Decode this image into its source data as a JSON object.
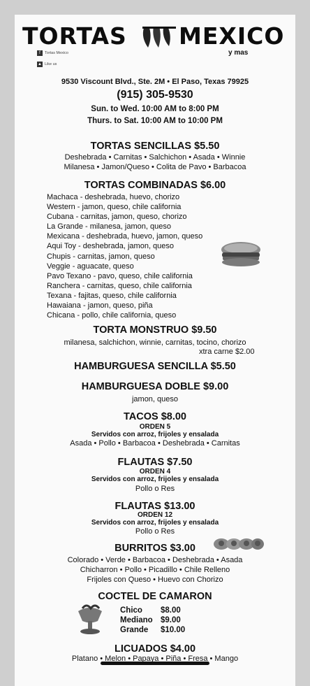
{
  "header": {
    "brand_left": "TORTAS",
    "brand_right": "MEXICO",
    "tagline": "y mas",
    "facebook_name": "Tortas Mexico",
    "like_label": "Like us"
  },
  "contact": {
    "address": "9530 Viscount Blvd., Ste. 2M  •  El Paso, Texas 79925",
    "phone": "(915) 305-9530",
    "hours_1": "Sun. to Wed.  10:00 AM to 8:00 PM",
    "hours_2": "Thurs. to Sat.  10:00 AM to 10:00 PM"
  },
  "menu": {
    "sencillas_title": "TORTAS SENCILLAS   $5.50",
    "sencillas_line1": "Deshebrada • Carnitas • Salchichon • Asada • Winnie",
    "sencillas_line2": "Milanesa • Jamon/Queso • Colita de Pavo • Barbacoa",
    "combinadas_title": "TORTAS COMBINADAS   $6.00",
    "combinadas": [
      "Machaca - deshebrada, huevo, chorizo",
      "Western - jamon, queso, chile california",
      "Cubana - carnitas, jamon, queso, chorizo",
      "La Grande - milanesa, jamon, queso",
      "Mexicana - deshebrada, huevo, jamon, queso",
      "Aqui Toy - deshebrada, jamon, queso",
      "Chupis - carnitas, jamon, queso",
      "Veggie - aguacate, queso",
      "Pavo Texano - pavo, queso, chile california",
      "Ranchera - carnitas, queso, chile california",
      "Texana - fajitas, queso, chile california",
      "Hawaiana - jamon, queso, piña",
      "Chicana - pollo, chile california, queso"
    ],
    "monstruo_title": "TORTA MONSTRUO   $9.50",
    "monstruo_desc": "milanesa, salchichon, winnie, carnitas, tocino, chorizo",
    "monstruo_extra": "xtra carne  $2.00",
    "hamb_sencilla": "HAMBURGUESA SENCILLA   $5.50",
    "hamb_doble": "HAMBURGUESA DOBLE   $9.00",
    "hamb_doble_desc": "jamon, queso",
    "tacos_title": "TACOS   $8.00",
    "tacos_orden": "ORDEN 5",
    "tacos_served": "Servidos con arroz, frijoles y ensalada",
    "tacos_options": "Asada • Pollo • Barbacoa • Deshebrada • Carnitas",
    "flautas4_title": "FLAUTAS   $7.50",
    "flautas4_orden": "ORDEN 4",
    "flautas4_served": "Servidos con arroz, frijoles y ensalada",
    "flautas4_options": "Pollo o Res",
    "flautas12_title": "FLAUTAS   $13.00",
    "flautas12_orden": "ORDEN 12",
    "flautas12_served": "Servidos con arroz, frijoles y ensalada",
    "flautas12_options": "Pollo o Res",
    "burritos_title": "BURRITOS   $3.00",
    "burritos_line1": "Colorado • Verde • Barbacoa • Deshebrada • Asada",
    "burritos_line2": "Chicharron • Pollo • Picadillo • Chile Relleno",
    "burritos_line3": "Frijoles con Queso • Huevo con Chorizo",
    "coctel_title": "COCTEL DE CAMARON",
    "coctel_sizes": [
      {
        "label": "Chico",
        "price": "$8.00"
      },
      {
        "label": "Mediano",
        "price": "$9.00"
      },
      {
        "label": "Grande",
        "price": "$10.00"
      }
    ],
    "licuados_title": "LICUADOS   $4.00",
    "licuados_options": "Platano • Melon • Papaya • Piña • Fresa • Mango"
  }
}
